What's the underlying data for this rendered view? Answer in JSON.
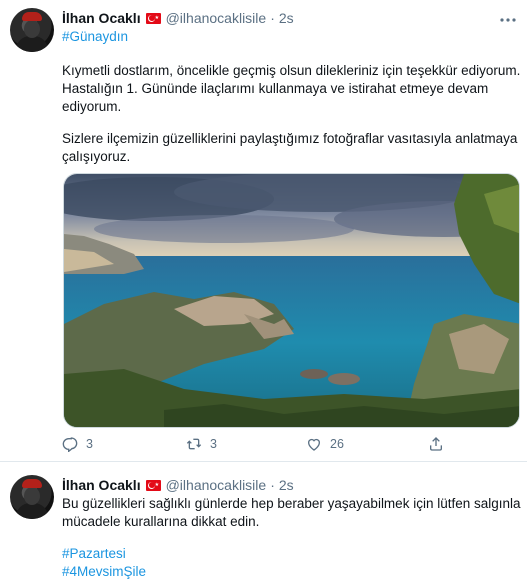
{
  "tweets": [
    {
      "author": "İlhan Ocaklı",
      "handle": "@ilhanocaklisile",
      "separator": "·",
      "time": "2s",
      "hashtag_top": "#Günaydın",
      "paragraph1_line1": "Kıymetli dostlarım, öncelikle geçmiş olsun dilekleriniz için teşekkür ediyorum.",
      "paragraph1_line2": "Hastalığın 1. Gününde ilaçlarımı kullanmaya ve istirahat etmeye devam",
      "paragraph1_line3": "ediyorum.",
      "paragraph2_line1": "Sizlere ilçemizin güzelliklerini paylaştığımız fotoğraflar vasıtasıyla anlatmaya",
      "paragraph2_line2": "çalışıyoruz.",
      "actions": {
        "reply_count": "3",
        "retweet_count": "3",
        "like_count": "26"
      }
    },
    {
      "author": "İlhan Ocaklı",
      "handle": "@ilhanocaklisile",
      "separator": "·",
      "time": "2s",
      "line1": "Bu güzellikleri sağlıklı günlerde hep beraber yaşayabilmek için lütfen salgınla",
      "line2": "mücadele kurallarına dikkat edin.",
      "hashtag1": "#Pazartesi",
      "hashtag2": "#4MevsimŞile"
    }
  ],
  "icons": {
    "reply": "reply-icon",
    "retweet": "retweet-icon",
    "like": "like-icon",
    "share": "share-icon",
    "more": "more-icon",
    "flag": "turkey-flag-icon"
  },
  "colors": {
    "link": "#1b95e0",
    "muted": "#5b7083",
    "text": "#0f1419"
  }
}
